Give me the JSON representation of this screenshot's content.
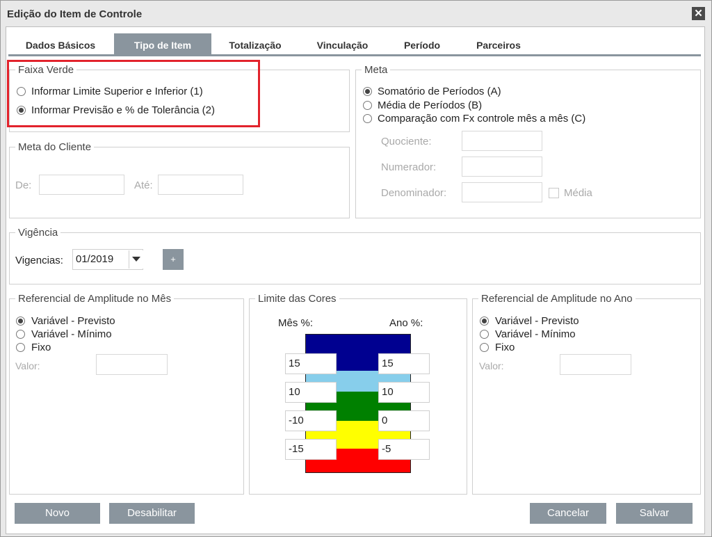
{
  "window": {
    "title": "Edição do Item de Controle",
    "close_icon": "close-icon"
  },
  "tabs": [
    "Dados Básicos",
    "Tipo de Item",
    "Totalização",
    "Vinculação",
    "Período",
    "Parceiros"
  ],
  "active_tab": "Tipo de Item",
  "faixa_verde": {
    "legend": "Faixa Verde",
    "options": [
      "Informar Limite Superior e Inferior (1)",
      "Informar Previsão e % de Tolerância (2)"
    ],
    "selected_index": 1
  },
  "meta": {
    "legend": "Meta",
    "options": [
      "Somatório de Períodos (A)",
      "Média de Períodos (B)",
      "Comparação com Fx controle mês a mês (C)"
    ],
    "selected_index": 0,
    "quociente_label": "Quociente:",
    "numerador_label": "Numerador:",
    "denominador_label": "Denominador:",
    "media_label": "Média"
  },
  "meta_cliente": {
    "legend": "Meta do Cliente",
    "de_label": "De:",
    "ate_label": "Até:"
  },
  "vigencia": {
    "legend": "Vigência",
    "vigencias_label": "Vigencias:",
    "selected": "01/2019",
    "add_label": "+"
  },
  "ref_mes": {
    "legend": "Referencial de Amplitude no Mês",
    "options": [
      "Variável - Previsto",
      "Variável - Mínimo",
      "Fixo"
    ],
    "selected_index": 0,
    "valor_label": "Valor:"
  },
  "limite_cores": {
    "legend": "Limite das Cores",
    "mes_label": "Mês %:",
    "ano_label": "Ano %:",
    "colors": [
      "#000090",
      "#87ceeb",
      "#008000",
      "#ffff00",
      "#ff0000"
    ],
    "mes_values": [
      "15",
      "10",
      "-10",
      "-15"
    ],
    "ano_values": [
      "15",
      "10",
      "0",
      "-5"
    ]
  },
  "ref_ano": {
    "legend": "Referencial de Amplitude no Ano",
    "options": [
      "Variável - Previsto",
      "Variável - Mínimo",
      "Fixo"
    ],
    "selected_index": 0,
    "valor_label": "Valor:"
  },
  "buttons": {
    "novo": "Novo",
    "desabilitar": "Desabilitar",
    "cancelar": "Cancelar",
    "salvar": "Salvar"
  }
}
